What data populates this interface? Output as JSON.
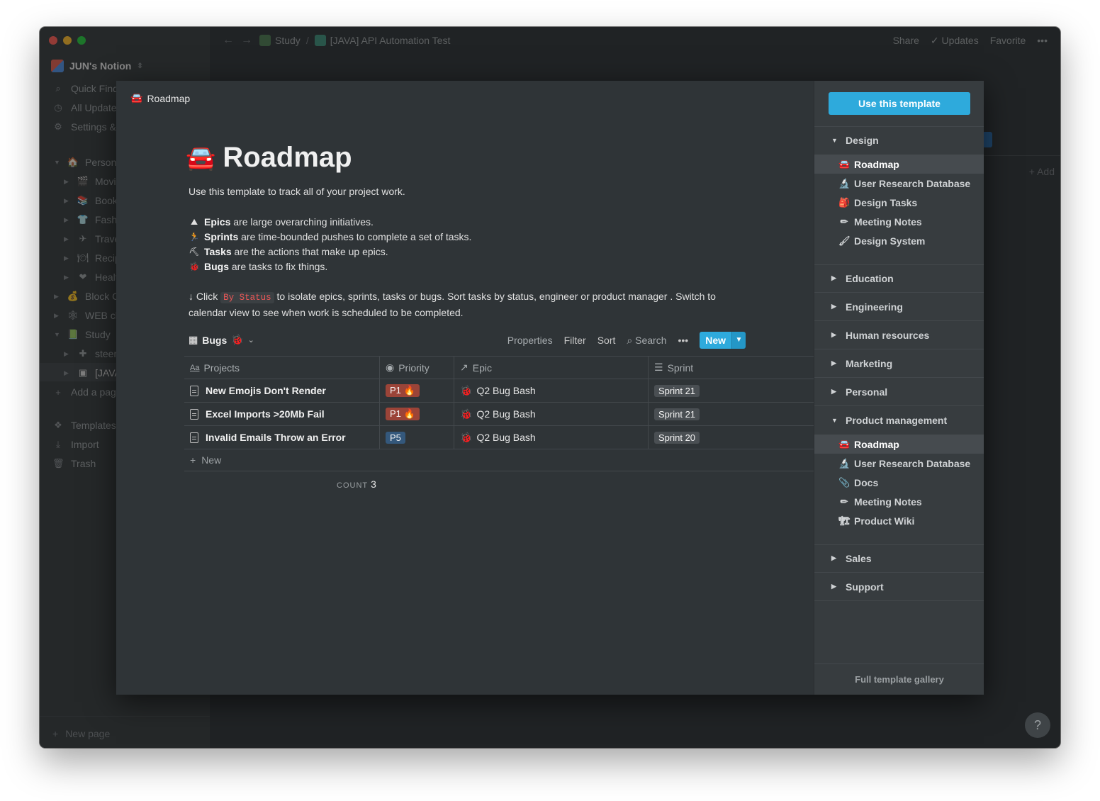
{
  "window": {
    "breadcrumb": [
      "Study",
      "[JAVA] API Automation Test"
    ],
    "actions": {
      "share": "Share",
      "updates": "Updates",
      "favorite": "Favorite",
      "more": "•••"
    }
  },
  "sidebar": {
    "workspace": "JUN's Notion",
    "quick_find": "Quick Find",
    "all_updates": "All Updates",
    "settings": "Settings &",
    "tree": [
      {
        "label": "Personal",
        "emoji": "🏠"
      },
      {
        "label": "Movi",
        "emoji": "🎬"
      },
      {
        "label": "Book",
        "emoji": "📚"
      },
      {
        "label": "Fashi",
        "emoji": "👕"
      },
      {
        "label": "Trave",
        "emoji": "✈"
      },
      {
        "label": "Recip",
        "emoji": "🍽"
      },
      {
        "label": "Healt",
        "emoji": "❤"
      },
      {
        "label": "Block C",
        "emoji": "💰"
      },
      {
        "label": "WEB cl",
        "emoji": "🕸"
      },
      {
        "label": "Study",
        "emoji": "📗"
      },
      {
        "label": "steer",
        "emoji": "✚"
      },
      {
        "label": "[JAVA",
        "emoji": "▣"
      }
    ],
    "add_page": "Add a pag",
    "templates": "Templates",
    "import": "Import",
    "trash": "Trash",
    "new_page": "New page"
  },
  "background": {
    "add_label": "+ Add",
    "help": "?"
  },
  "preview": {
    "header": "Roadmap",
    "title": "Roadmap",
    "title_emoji": "🚘",
    "description": "Use this template to track all of your project work.",
    "bullets": [
      {
        "emoji": "⛰",
        "bold": "Epics",
        "text": " are large overarching initiatives."
      },
      {
        "emoji": "🏃",
        "bold": "Sprints",
        "text": " are time-bounded pushes to complete a set of tasks."
      },
      {
        "emoji": "⛏",
        "bold": "Tasks",
        "text": " are the actions that make up epics."
      },
      {
        "emoji": "🐞",
        "bold": "Bugs",
        "text": " are tasks to fix things."
      }
    ],
    "note_pre": "↓ Click",
    "note_code": "By Status",
    "note_post": "to isolate epics, sprints, tasks or bugs. Sort tasks by status, engineer or product manager . Switch to calendar view to see when work is scheduled to be completed.",
    "db": {
      "name": "Bugs",
      "name_emoji": "🐞",
      "tools": {
        "properties": "Properties",
        "filter": "Filter",
        "sort": "Sort",
        "search": "Search",
        "more": "•••",
        "new": "New"
      },
      "columns": [
        "Projects",
        "Priority",
        "Epic",
        "Sprint"
      ],
      "rows": [
        {
          "project": "New Emojis Don't Render",
          "priority": "P1 🔥",
          "epic": "Q2 Bug Bash",
          "sprint": "Sprint 21"
        },
        {
          "project": "Excel Imports >20Mb Fail",
          "priority": "P1 🔥",
          "epic": "Q2 Bug Bash",
          "sprint": "Sprint 21"
        },
        {
          "project": "Invalid Emails Throw an Error",
          "priority": "P5",
          "epic": "Q2 Bug Bash",
          "sprint": "Sprint 20"
        }
      ],
      "new_row": "New",
      "count_label": "COUNT",
      "count_value": "3"
    }
  },
  "panel": {
    "use_template": "Use this template",
    "categories": {
      "design": "Design",
      "education": "Education",
      "engineering": "Engineering",
      "human_resources": "Human resources",
      "marketing": "Marketing",
      "personal": "Personal",
      "product_management": "Product management",
      "sales": "Sales",
      "support": "Support"
    },
    "design_items": [
      {
        "emoji": "🚘",
        "label": "Roadmap"
      },
      {
        "emoji": "🔬",
        "label": "User Research Database"
      },
      {
        "emoji": "🎒",
        "label": "Design Tasks"
      },
      {
        "emoji": "✏",
        "label": "Meeting Notes"
      },
      {
        "emoji": "🖌",
        "label": "Design System"
      }
    ],
    "pm_items": [
      {
        "emoji": "🚘",
        "label": "Roadmap"
      },
      {
        "emoji": "🔬",
        "label": "User Research Database"
      },
      {
        "emoji": "📎",
        "label": "Docs"
      },
      {
        "emoji": "✏",
        "label": "Meeting Notes"
      },
      {
        "emoji": "🏗",
        "label": "Product Wiki"
      }
    ],
    "gallery": "Full template gallery"
  }
}
